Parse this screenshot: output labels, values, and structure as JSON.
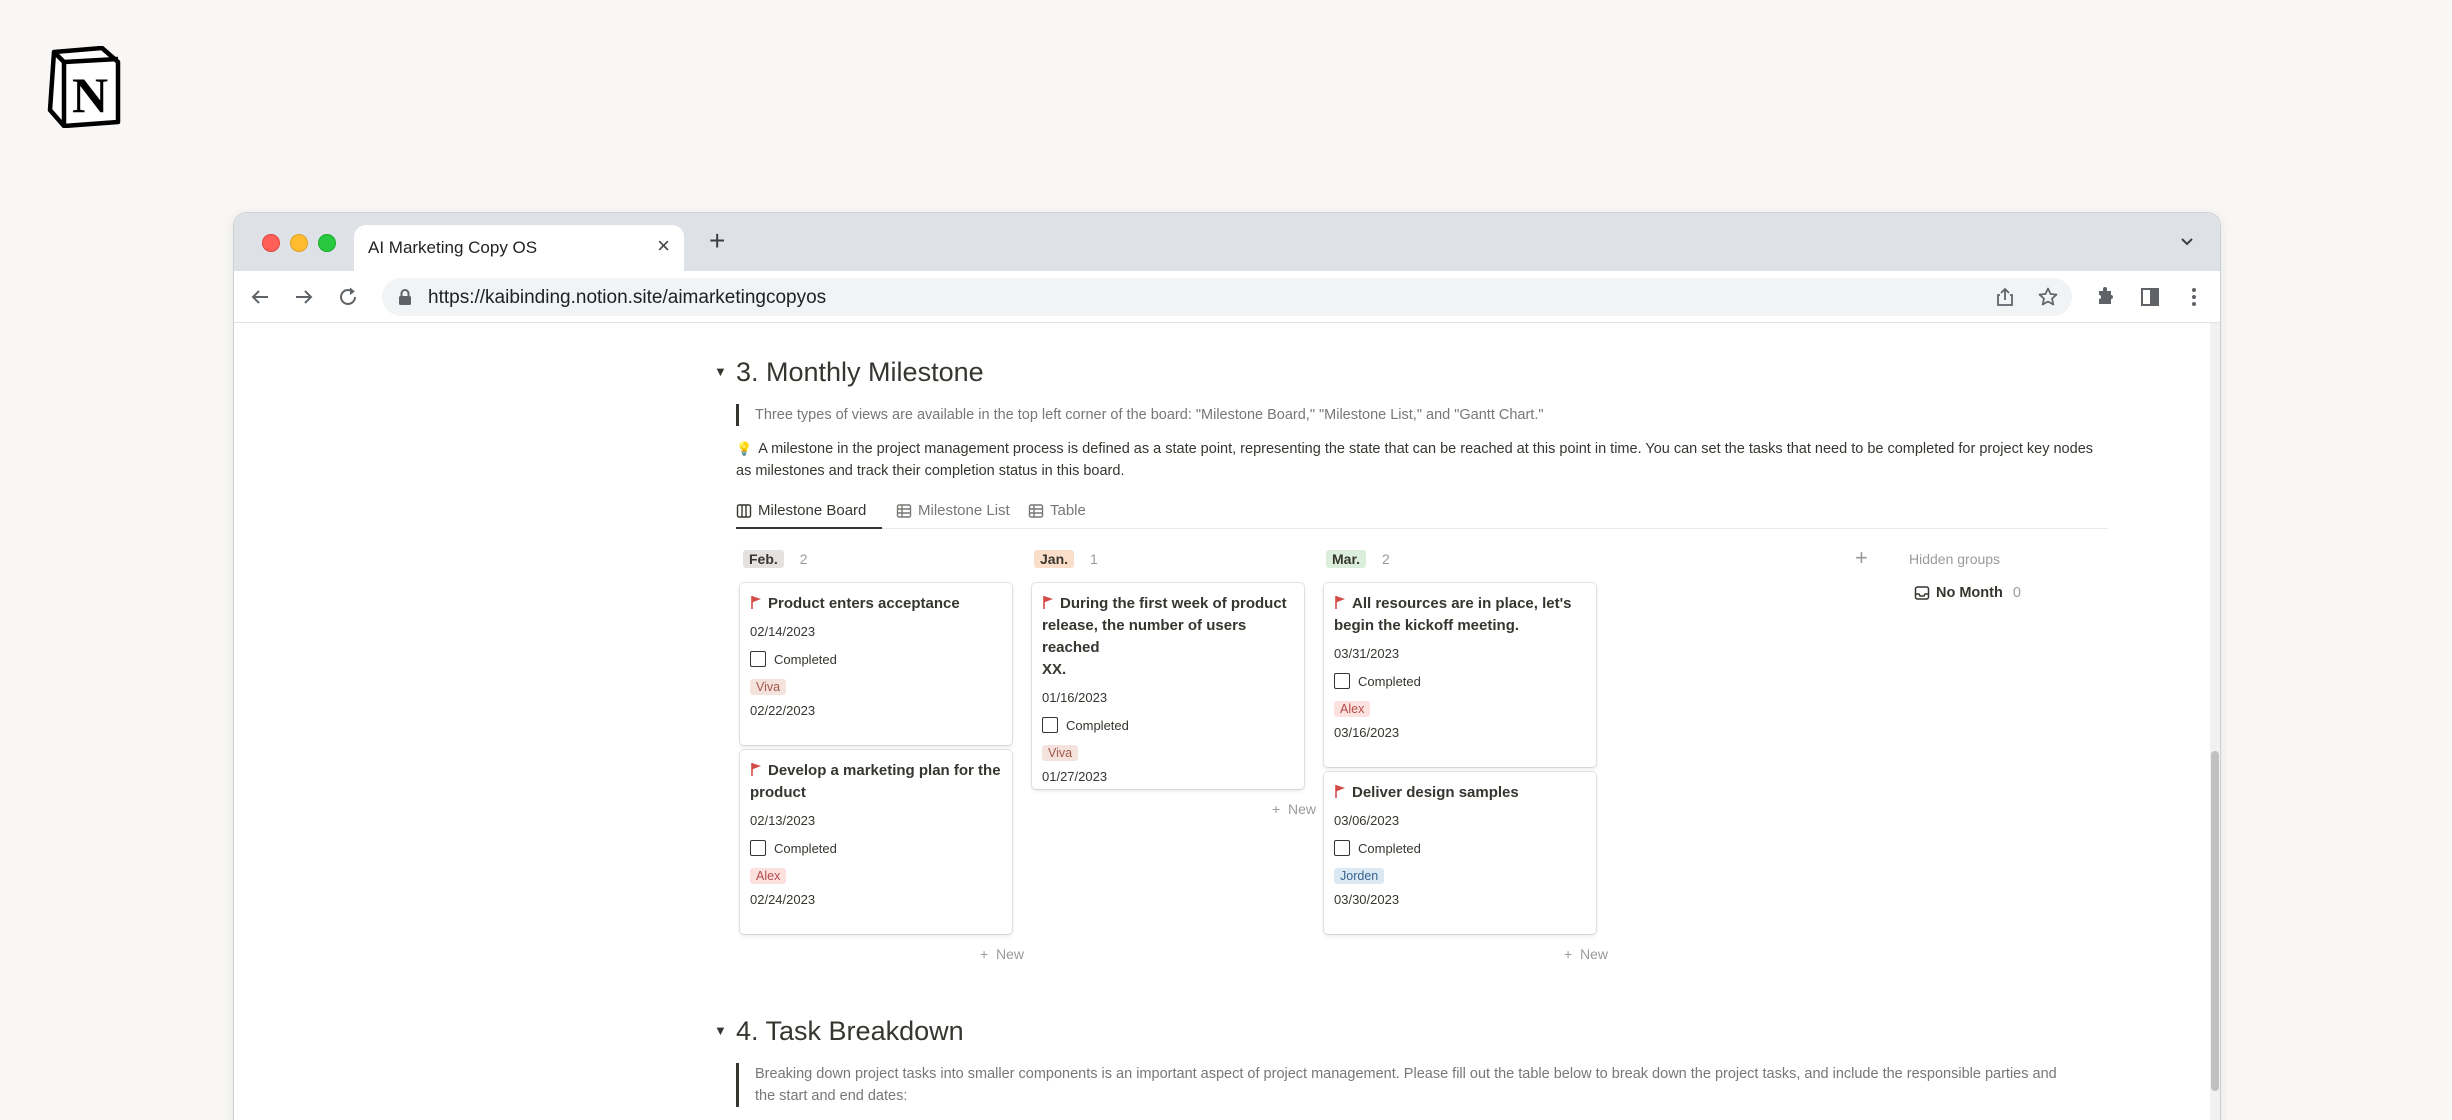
{
  "logo": {
    "icon": "notion-logo",
    "letter": "N"
  },
  "browser": {
    "tab_title": "AI Marketing Copy OS",
    "tab_close": "×",
    "new_tab": "+",
    "url": "https://kaibinding.notion.site/aimarketingcopyos"
  },
  "section3": {
    "title": "3. Monthly Milestone",
    "quote": "Three types of views are available in the top left corner of the board: \"Milestone Board,\" \"Milestone List,\" and \"Gantt Chart.\"",
    "callout_emoji": "💡",
    "callout_line1": "A milestone in the project management process is defined as a state point, representing the state that can be reached at this point in time. You can set the tasks that need to be completed for project key nodes",
    "callout_line2": "as milestones and track their completion status in this board.",
    "views": [
      {
        "label": "Milestone Board",
        "icon": "board-icon"
      },
      {
        "label": "Milestone List",
        "icon": "table-icon"
      },
      {
        "label": "Table",
        "icon": "table-icon"
      }
    ],
    "columns": [
      {
        "month": "Feb.",
        "count": "2",
        "color": "#e3e2e0"
      },
      {
        "month": "Jan.",
        "count": "1",
        "color": "#fadec9"
      },
      {
        "month": "Mar.",
        "count": "2",
        "color": "#dbeddb"
      }
    ],
    "cards": {
      "feb1": {
        "title": "Product enters acceptance",
        "date": "02/14/2023",
        "check": "Completed",
        "person": "Viva",
        "date2": "02/22/2023"
      },
      "feb2": {
        "title1": "Develop a marketing plan for the",
        "title2": "product",
        "date": "02/13/2023",
        "check": "Completed",
        "person": "Alex",
        "date2": "02/24/2023"
      },
      "jan1": {
        "title1": "During the first week of product",
        "title2": "release, the number of users reached",
        "title3": "XX.",
        "date": "01/16/2023",
        "check": "Completed",
        "person": "Viva",
        "date2": "01/27/2023"
      },
      "mar1": {
        "title1": "All resources are in place, let's",
        "title2": "begin the kickoff meeting.",
        "date": "03/31/2023",
        "check": "Completed",
        "person": "Alex",
        "date2": "03/16/2023"
      },
      "mar2": {
        "title": "Deliver design samples",
        "date": "03/06/2023",
        "check": "Completed",
        "person": "Jorden",
        "date2": "03/30/2023"
      }
    },
    "new_label": "New",
    "add_group": "+",
    "hidden_groups": "Hidden groups",
    "no_month": {
      "label": "No Month",
      "count": "0"
    }
  },
  "section4": {
    "title": "4. Task Breakdown",
    "quote_line1": "Breaking down project tasks into smaller components is an important aspect of project management. Please fill out the table below to break down the project tasks, and include the responsible parties and",
    "quote_line2": "the start and end dates:"
  }
}
